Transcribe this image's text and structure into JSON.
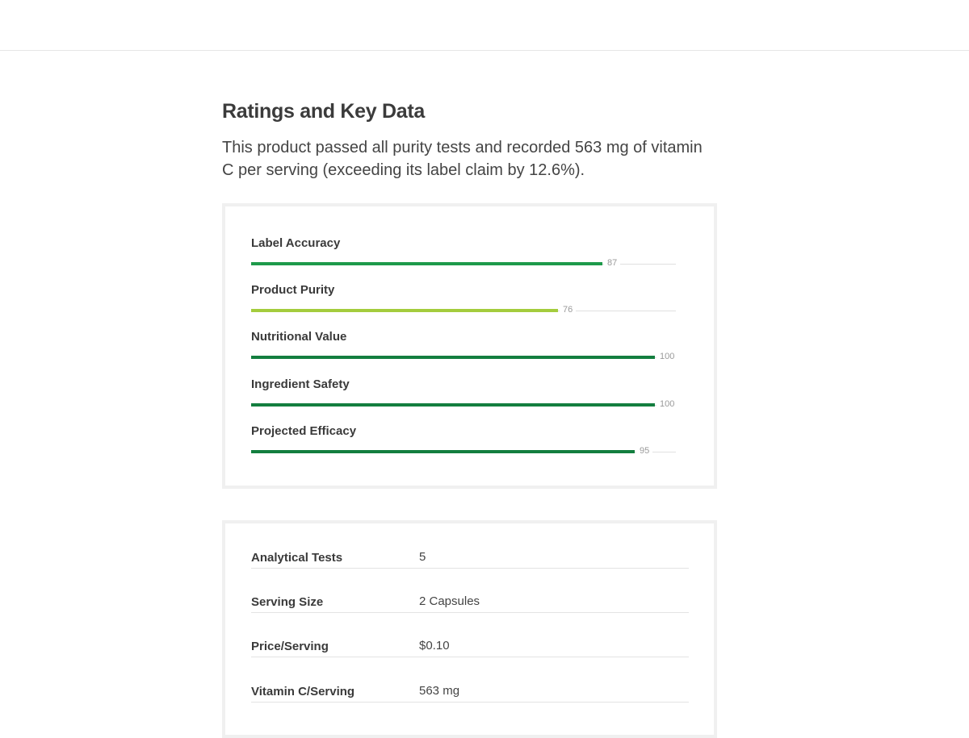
{
  "header": {},
  "section": {
    "title": "Ratings and Key Data",
    "intro": "This product passed all purity tests and recorded 563 mg of vitamin C per serving (exceeding its label claim by 12.6%)."
  },
  "ratings": [
    {
      "label": "Label Accuracy",
      "score": 87,
      "score_text": "87",
      "color": "#1e9a4a"
    },
    {
      "label": "Product Purity",
      "score": 76,
      "score_text": "76",
      "color": "#a4cc3d"
    },
    {
      "label": "Nutritional Value",
      "score": 100,
      "score_text": "100",
      "color": "#137e3f"
    },
    {
      "label": "Ingredient Safety",
      "score": 100,
      "score_text": "100",
      "color": "#137e3f"
    },
    {
      "label": "Projected Efficacy",
      "score": 95,
      "score_text": "95",
      "color": "#137e3f"
    }
  ],
  "key_data": [
    {
      "label": "Analytical Tests",
      "value": "5"
    },
    {
      "label": "Serving Size",
      "value": "2 Capsules"
    },
    {
      "label": "Price/Serving",
      "value": "$0.10"
    },
    {
      "label": "Vitamin C/Serving",
      "value": "563 mg"
    }
  ]
}
